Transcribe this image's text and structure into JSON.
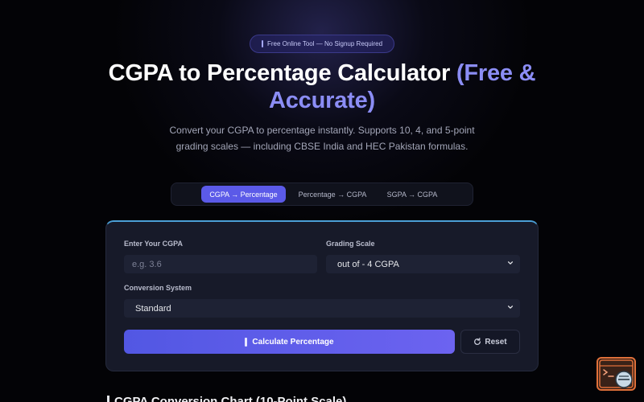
{
  "badge": {
    "text": "Free Online Tool — No Signup Required"
  },
  "hero": {
    "title_main": "CGPA to Percentage Calculator ",
    "title_accent": "(Free & Accurate)",
    "subtitle": "Convert your CGPA to percentage instantly. Supports 10, 4, and 5-point grading scales — including CBSE India and HEC Pakistan formulas."
  },
  "tabs": [
    {
      "label": "CGPA → Percentage",
      "active": true
    },
    {
      "label": "Percentage → CGPA",
      "active": false
    },
    {
      "label": "SGPA → CGPA",
      "active": false
    }
  ],
  "form": {
    "cgpa_label": "Enter Your CGPA",
    "cgpa_placeholder": "e.g. 3.6",
    "cgpa_value": "",
    "scale_label": "Grading Scale",
    "scale_value": "out of - 4 CGPA",
    "system_label": "Conversion System",
    "system_value": "Standard",
    "calculate_label": "Calculate Percentage",
    "reset_label": "Reset"
  },
  "next_section": {
    "heading": "CGPA Conversion Chart (10-Point Scale)"
  },
  "colors": {
    "accent": "#5b5ae8",
    "accent_text": "#8b8df5",
    "card_border_top": "#4b9fd6",
    "widget_border": "#e0703a"
  },
  "icons": {
    "badge": "bar-icon",
    "calculate": "bar-icon",
    "reset": "refresh-icon",
    "select": "chevron-down-icon",
    "widget": "chat-support-icon"
  }
}
